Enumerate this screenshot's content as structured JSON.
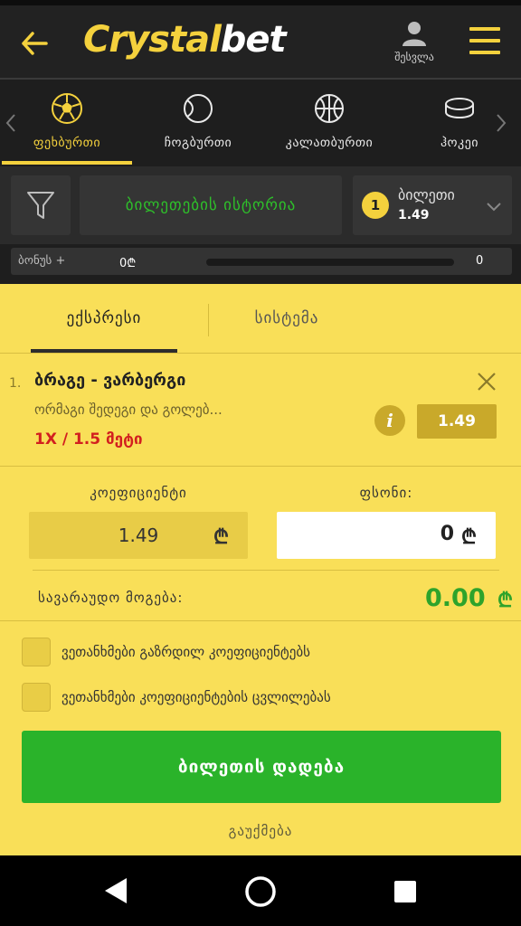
{
  "header": {
    "logo_part1": "Crystal",
    "logo_part2": "bet",
    "profile_label": "შესვლა"
  },
  "sports_tabs": [
    {
      "label": "ფეხბურთი",
      "icon": "soccer-ball-icon",
      "active": true
    },
    {
      "label": "ჩოგბურთი",
      "icon": "tennis-ball-icon",
      "active": false
    },
    {
      "label": "კალათბურთი",
      "icon": "basketball-icon",
      "active": false
    },
    {
      "label": "ჰოკეი",
      "icon": "hockey-puck-icon",
      "active": false
    }
  ],
  "toolbar": {
    "history_label": "ბილეთების ისტორია",
    "ticket_count": "1",
    "ticket_label": "ბილეთი",
    "ticket_odds": "1.49"
  },
  "bonus": {
    "label": "ბონუს +",
    "left_value": "0₾",
    "right_value": "0",
    "progress": 0
  },
  "betslip": {
    "tabs": {
      "express": "ექსპრესი",
      "system": "სისტემა"
    },
    "bet": {
      "number": "1.",
      "match": "ბრაგე - ვარბერგი",
      "market": "ორმაგი შედეგი და გოლებ...",
      "pick": "1X / 1.5 მეტი",
      "odds": "1.49"
    },
    "coefficient_label": "კოეფიციენტი",
    "coefficient_value": "1.49",
    "amount_label": "ფსონი:",
    "amount_value": "0",
    "currency": "₾",
    "possible_win_label": "სავარაუდო მოგება:",
    "possible_win_value": "0.00",
    "agree_increase": "ვეთანხმები გაზრდილ კოეფიციენტებს",
    "agree_change": "ვეთანხმები კოეფიციენტების ცვლილებას",
    "place_bet": "ბილეთის დადება",
    "cancel": "გაუქმება"
  },
  "colors": {
    "accent_yellow": "#f4d13d",
    "panel_yellow": "#f9df58",
    "green": "#2ab32a",
    "red": "#d21f1f"
  }
}
